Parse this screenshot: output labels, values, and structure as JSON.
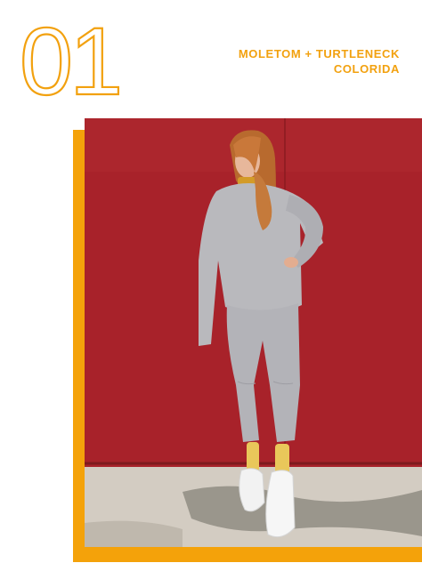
{
  "section_number": "01",
  "heading": {
    "line1": "MOLETOM + TURTLENECK",
    "line2": "COLORIDA"
  },
  "colors": {
    "accent": "#f2a10f",
    "wall": "#a8222a",
    "sweat": "#b9b9bd",
    "ground": "#cfc8be"
  },
  "photo": {
    "subject": "woman in grey sweatsuit, yellow turtleneck and socks, white sneakers, leaning against red wall"
  }
}
